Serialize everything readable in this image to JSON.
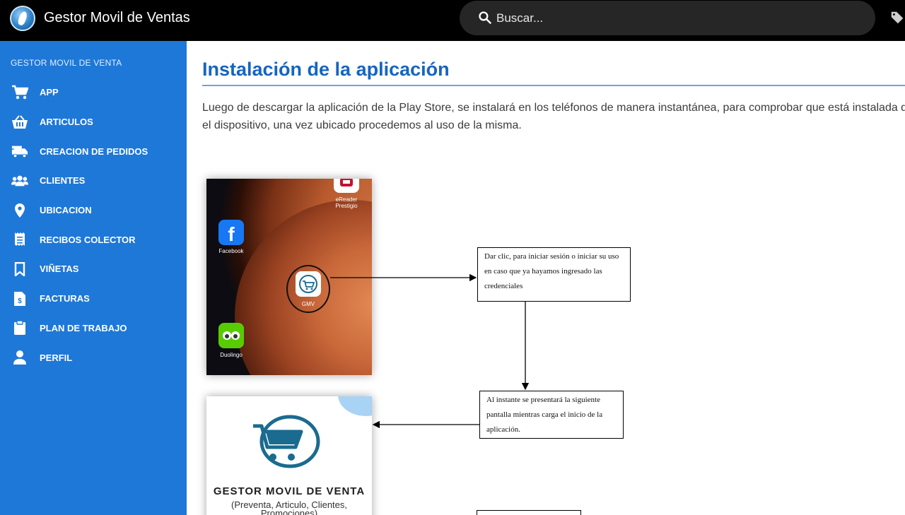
{
  "header": {
    "app_title": "Gestor Movil de Ventas",
    "search_placeholder": "Buscar...",
    "icons": [
      "app-logo-icon",
      "search-icon",
      "tag-icon"
    ]
  },
  "sidebar": {
    "heading": "GESTOR MOVIL DE VENTA",
    "items": [
      {
        "label": "APP",
        "icon": "cart-icon"
      },
      {
        "label": "ARTICULOS",
        "icon": "basket-icon"
      },
      {
        "label": "CREACION DE PEDIDOS",
        "icon": "truck-icon"
      },
      {
        "label": "CLIENTES",
        "icon": "users-icon"
      },
      {
        "label": "UBICACION",
        "icon": "map-pin-icon"
      },
      {
        "label": "RECIBOS COLECTOR",
        "icon": "receipt-icon"
      },
      {
        "label": "VIÑETAS",
        "icon": "bookmark-icon"
      },
      {
        "label": "FACTURAS",
        "icon": "invoice-icon"
      },
      {
        "label": "PLAN DE TRABAJO",
        "icon": "clipboard-icon"
      },
      {
        "label": "PERFIL",
        "icon": "user-icon"
      }
    ]
  },
  "main": {
    "title": "Instalación de la aplicación",
    "paragraph": "Luego de descargar la aplicación de la Play Store, se instalará en los teléfonos de manera instantánea, para comprobar que está instalada de la misma en el dispositivo, una vez ubicado procedemos al uso de la misma.",
    "phone_screen": {
      "apps": {
        "facebook": "Facebook",
        "gmv": "GMV",
        "duolingo": "Duolingo",
        "ereader": "eReader Prestigio"
      }
    },
    "splash": {
      "title": "GESTOR MOVIL DE VENTA",
      "subtitle": "(Preventa, Articulo, Clientes, Promociones)"
    },
    "notes": [
      "Dar clic, para iniciar sesión o iniciar su uso en caso que ya hayamos ingresado las credenciales",
      "Al instante se presentará la siguiente pantalla mientras carga el inicio de la aplicación."
    ]
  },
  "colors": {
    "topbar": "#000000",
    "sidebar": "#1e78d8",
    "title": "#1565c0",
    "splash_logo": "#1a6b8f"
  }
}
